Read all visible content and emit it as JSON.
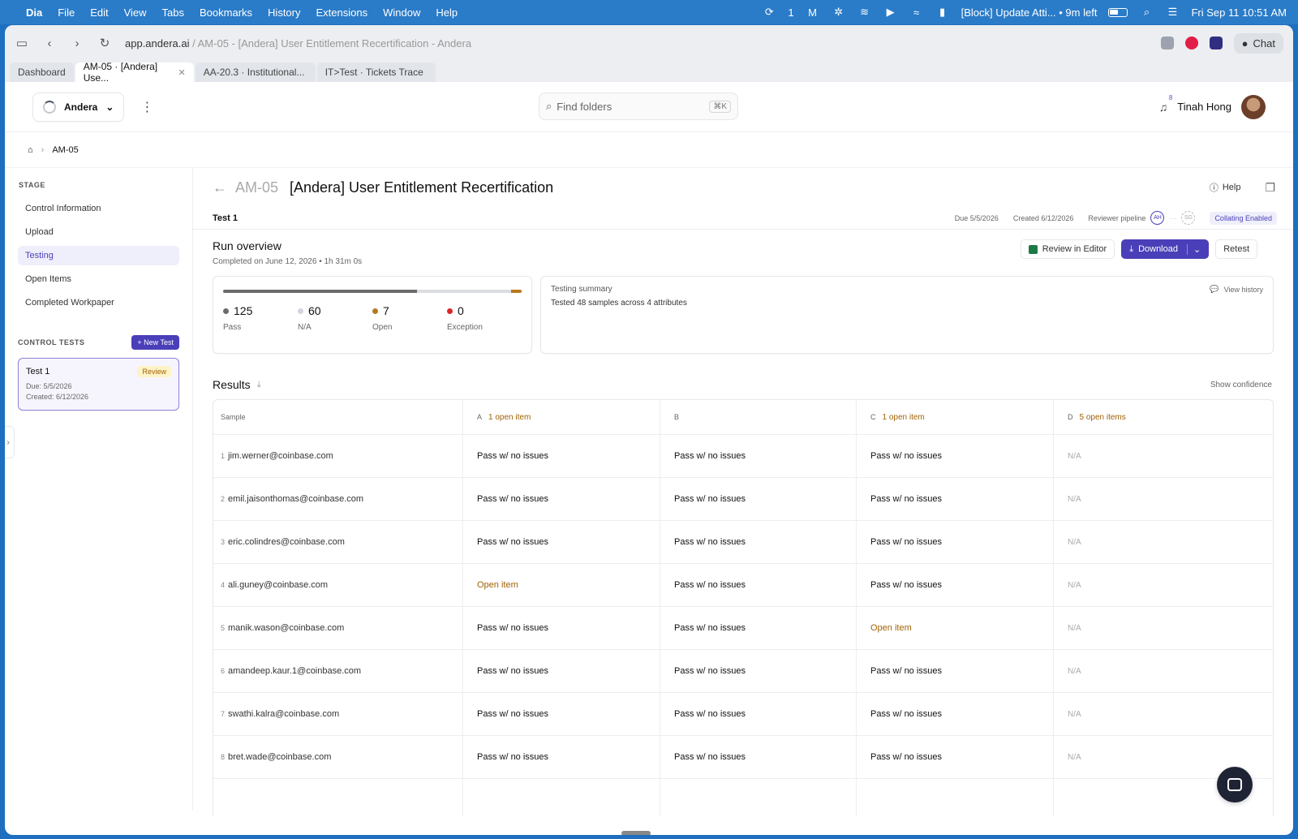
{
  "menubar": {
    "app": "Dia",
    "items": [
      "File",
      "Edit",
      "View",
      "Tabs",
      "Bookmarks",
      "History",
      "Extensions",
      "Window",
      "Help"
    ],
    "notif_count": "1",
    "now_playing": "[Block] Update Atti... • 9m left",
    "datetime": "Fri Sep 11  10:51 AM"
  },
  "browser": {
    "url_domain": "app.andera.ai",
    "url_rest": " / AM-05 - [Andera] User Entitlement Recertification - Andera",
    "chat_label": "Chat",
    "tabs": [
      {
        "label": "Dashboard"
      },
      {
        "label": "AM-05 · [Andera] Use..."
      },
      {
        "label": "AA-20.3 · Institutional..."
      },
      {
        "label": "IT>Test · Tickets Trace"
      }
    ]
  },
  "header": {
    "org": "Andera",
    "search_placeholder": "Find folders",
    "search_kbd": "⌘K",
    "notif_count": "8",
    "user_name": "Tinah Hong"
  },
  "breadcrumb": {
    "current": "AM-05"
  },
  "sidebar": {
    "stage_heading": "STAGE",
    "stages": [
      "Control Information",
      "Upload",
      "Testing",
      "Open Items",
      "Completed Workpaper"
    ],
    "active_stage": "Testing",
    "control_tests_heading": "CONTROL TESTS",
    "new_test_label": "+ New Test",
    "test_card": {
      "name": "Test 1",
      "badge": "Review",
      "due": "Due: 5/5/2026",
      "created": "Created: 6/12/2026"
    }
  },
  "page": {
    "code": "AM-05",
    "title": "[Andera] User Entitlement Recertification",
    "help_label": "Help",
    "test_name": "Test 1",
    "due": "Due 5/5/2026",
    "created": "Created 6/12/2026",
    "pipeline_label": "Reviewer pipeline",
    "reviewer1": "AH",
    "reviewer2": "SG",
    "collating": "Collating Enabled"
  },
  "run": {
    "title": "Run overview",
    "completed": "Completed on June 12, 2026 • 1h 31m 0s",
    "review_editor": "Review in Editor",
    "download": "Download",
    "retest": "Retest",
    "stats": [
      {
        "value": "125",
        "label": "Pass",
        "color": "#6b6b6b"
      },
      {
        "value": "60",
        "label": "N/A",
        "color": "#d1d5db"
      },
      {
        "value": "7",
        "label": "Open",
        "color": "#b7791f"
      },
      {
        "value": "0",
        "label": "Exception",
        "color": "#dc2626"
      }
    ],
    "summary_heading": "Testing summary",
    "summary_text": "Tested 48 samples across 4 attributes",
    "view_history": "View history"
  },
  "results": {
    "title": "Results",
    "show_confidence": "Show confidence",
    "columns": [
      {
        "key": "Sample",
        "open": ""
      },
      {
        "key": "A",
        "open": "1 open item"
      },
      {
        "key": "B",
        "open": ""
      },
      {
        "key": "C",
        "open": "1 open item"
      },
      {
        "key": "D",
        "open": "5 open items"
      }
    ],
    "rows": [
      {
        "n": "1",
        "sample": "jim.werner@coinbase.com",
        "a": "Pass w/ no issues",
        "b": "Pass w/ no issues",
        "c": "Pass w/ no issues",
        "d": "N/A"
      },
      {
        "n": "2",
        "sample": "emil.jaisonthomas@coinbase.com",
        "a": "Pass w/ no issues",
        "b": "Pass w/ no issues",
        "c": "Pass w/ no issues",
        "d": "N/A"
      },
      {
        "n": "3",
        "sample": "eric.colindres@coinbase.com",
        "a": "Pass w/ no issues",
        "b": "Pass w/ no issues",
        "c": "Pass w/ no issues",
        "d": "N/A"
      },
      {
        "n": "4",
        "sample": "ali.guney@coinbase.com",
        "a": "Open item",
        "b": "Pass w/ no issues",
        "c": "Pass w/ no issues",
        "d": "N/A"
      },
      {
        "n": "5",
        "sample": "manik.wason@coinbase.com",
        "a": "Pass w/ no issues",
        "b": "Pass w/ no issues",
        "c": "Open item",
        "d": "N/A"
      },
      {
        "n": "6",
        "sample": "amandeep.kaur.1@coinbase.com",
        "a": "Pass w/ no issues",
        "b": "Pass w/ no issues",
        "c": "Pass w/ no issues",
        "d": "N/A"
      },
      {
        "n": "7",
        "sample": "swathi.kalra@coinbase.com",
        "a": "Pass w/ no issues",
        "b": "Pass w/ no issues",
        "c": "Pass w/ no issues",
        "d": "N/A"
      },
      {
        "n": "8",
        "sample": "bret.wade@coinbase.com",
        "a": "Pass w/ no issues",
        "b": "Pass w/ no issues",
        "c": "Pass w/ no issues",
        "d": "N/A"
      }
    ]
  }
}
